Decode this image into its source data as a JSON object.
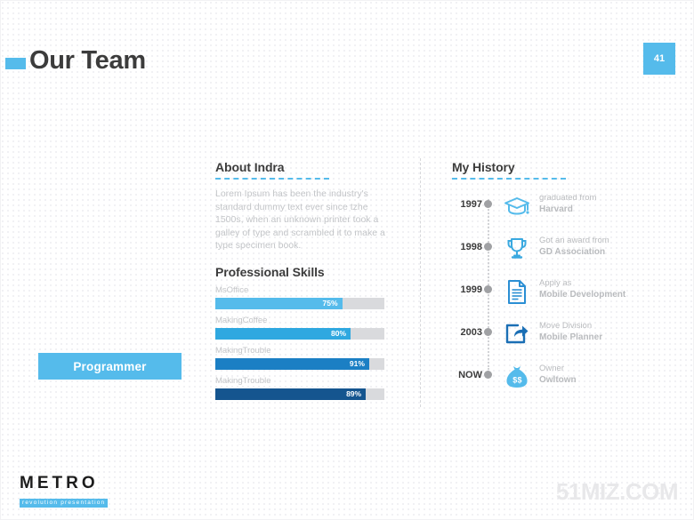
{
  "header": {
    "title": "Our Team",
    "page_number": "41",
    "accent_color": "#55bbeb"
  },
  "role": {
    "label": "Programmer"
  },
  "about": {
    "heading": "About Indra",
    "body": "Lorem Ipsum has been the industry's standard dummy text ever since tzhe 1500s, when an unknown printer took a galley of type and scrambled it to make a type specimen book.",
    "skills_heading": "Professional Skills",
    "skills": [
      {
        "label": "MsOffice",
        "percent": 75,
        "percent_label": "75%",
        "color": "#55bbeb"
      },
      {
        "label": "MakingCoffee",
        "percent": 80,
        "percent_label": "80%",
        "color": "#2fa8e0"
      },
      {
        "label": "MakingTrouble",
        "percent": 91,
        "percent_label": "91%",
        "color": "#1b7fc4"
      },
      {
        "label": "MakingTrouble",
        "percent": 89,
        "percent_label": "89%",
        "color": "#15558f"
      }
    ],
    "track_color": "#d9dadd"
  },
  "history": {
    "heading": "My History",
    "entries": [
      {
        "year": "1997",
        "top": "graduated from",
        "bottom": "Harvard",
        "icon": "graduation-cap-icon",
        "icon_color": "#55bbeb"
      },
      {
        "year": "1998",
        "top": "Got an award from",
        "bottom": "GD Association",
        "icon": "trophy-icon",
        "icon_color": "#3aa9e0"
      },
      {
        "year": "1999",
        "top": "Apply as",
        "bottom": "Mobile Development",
        "icon": "document-icon",
        "icon_color": "#2b8fd4"
      },
      {
        "year": "2003",
        "top": "Move Division",
        "bottom": "Mobile Planner",
        "icon": "share-export-icon",
        "icon_color": "#1b6fb5"
      },
      {
        "year": "NOW",
        "top": "Owner",
        "bottom": "Owltown",
        "icon": "money-bag-icon",
        "icon_color": "#55bbeb"
      }
    ]
  },
  "footer": {
    "logo_word": "METRO",
    "logo_tagline": "revolution presentation",
    "watermark": "51MIZ.COM"
  }
}
